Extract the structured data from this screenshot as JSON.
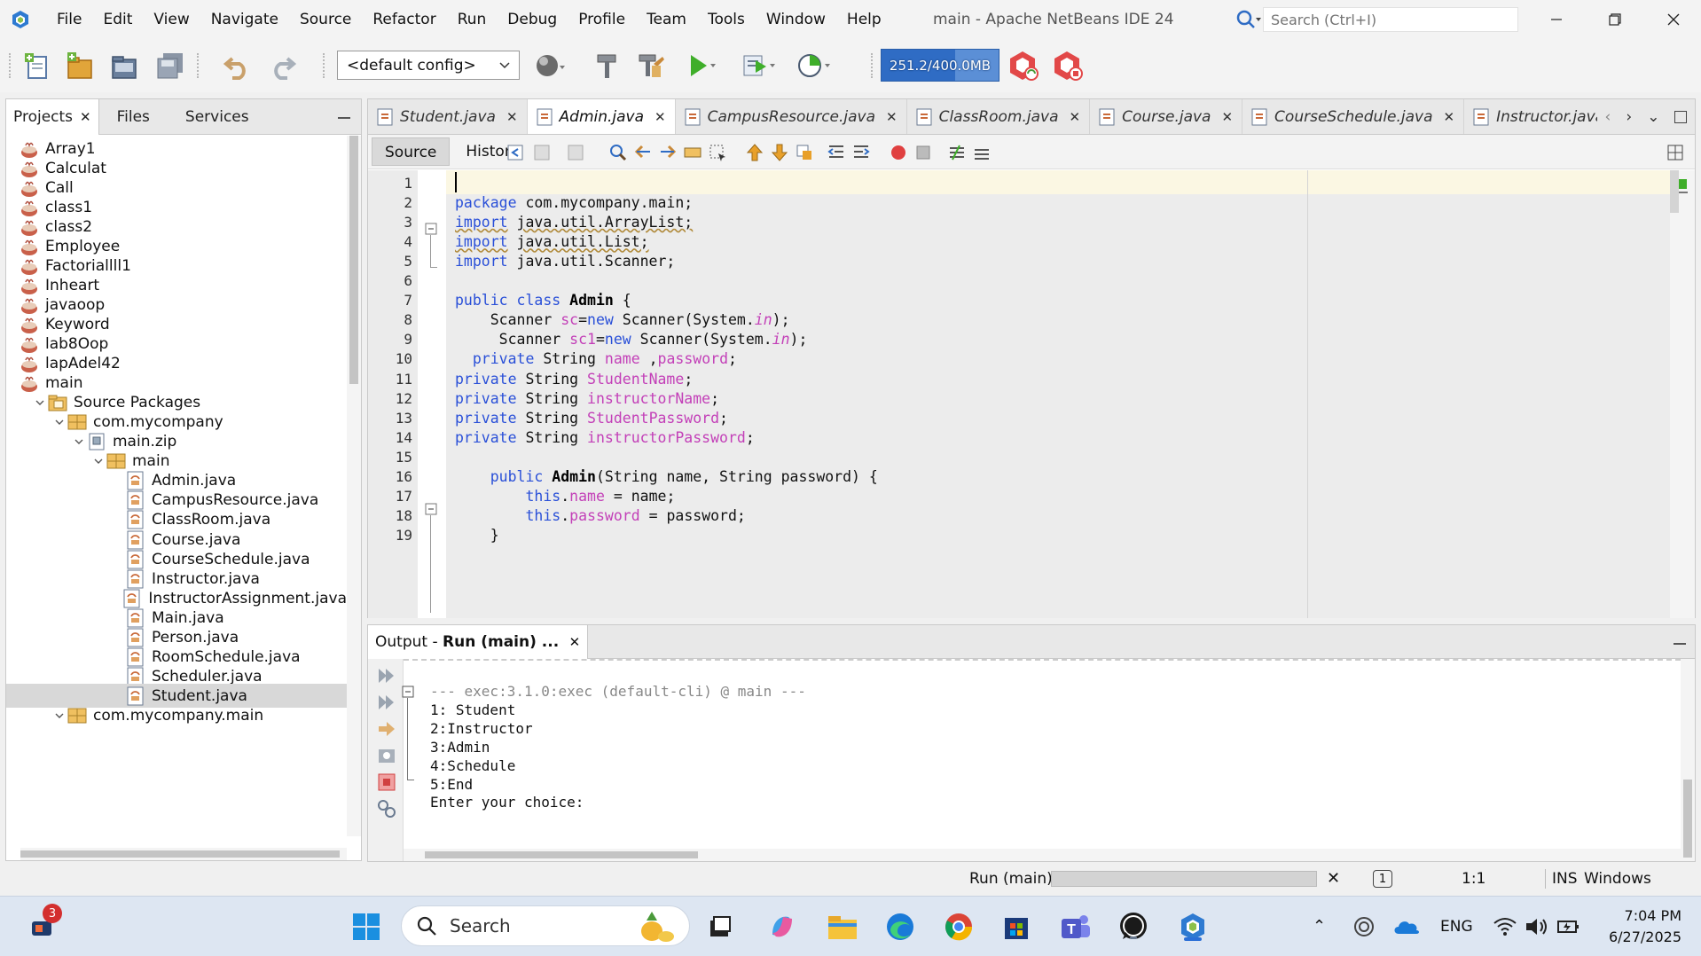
{
  "window": {
    "title": "main - Apache NetBeans IDE 24",
    "menu": [
      "File",
      "Edit",
      "View",
      "Navigate",
      "Source",
      "Refactor",
      "Run",
      "Debug",
      "Profile",
      "Team",
      "Tools",
      "Window",
      "Help"
    ],
    "search_placeholder": "Search (Ctrl+I)"
  },
  "toolbar": {
    "config_value": "<default config>",
    "memory_label": "251.2/400.0MB",
    "memory_fraction": 0.628
  },
  "projects_panel": {
    "tabs": [
      "Projects",
      "Files",
      "Services"
    ],
    "items": [
      {
        "label": "Array1"
      },
      {
        "label": "Calculat"
      },
      {
        "label": "Call"
      },
      {
        "label": "class1"
      },
      {
        "label": "class2"
      },
      {
        "label": "Employee"
      },
      {
        "label": "Factoriallll1"
      },
      {
        "label": "Inheart"
      },
      {
        "label": "javaoop"
      },
      {
        "label": "Keyword"
      },
      {
        "label": "lab8Oop"
      },
      {
        "label": "lapAdel42"
      },
      {
        "label": "main"
      },
      {
        "label": "Source Packages"
      },
      {
        "label": "com.mycompany"
      },
      {
        "label": "main.zip"
      },
      {
        "label": "main"
      },
      {
        "label": "Admin.java"
      },
      {
        "label": "CampusResource.java"
      },
      {
        "label": "ClassRoom.java"
      },
      {
        "label": "Course.java"
      },
      {
        "label": "CourseSchedule.java"
      },
      {
        "label": "Instructor.java"
      },
      {
        "label": "InstructorAssignment.java"
      },
      {
        "label": "Main.java"
      },
      {
        "label": "Person.java"
      },
      {
        "label": "RoomSchedule.java"
      },
      {
        "label": "Scheduler.java"
      },
      {
        "label": "Student.java"
      },
      {
        "label": "com.mycompany.main"
      }
    ]
  },
  "editor": {
    "tabs": [
      "Student.java",
      "Admin.java",
      "CampusResource.java",
      "ClassRoom.java",
      "Course.java",
      "CourseSchedule.java",
      "Instructor.java..."
    ],
    "active_tab": "Admin.java",
    "view_tabs": [
      "Source",
      "History"
    ],
    "line_numbers": [
      "1",
      "2",
      "3",
      "4",
      "5",
      "6",
      "7",
      "8",
      "9",
      "10",
      "11",
      "12",
      "13",
      "14",
      "15",
      "16",
      "17",
      "18",
      "19"
    ],
    "lines": [
      "",
      "package com.mycompany.main;",
      "import java.util.ArrayList;",
      "import java.util.List;",
      "import java.util.Scanner;",
      "",
      "public class Admin {",
      "    Scanner sc=new Scanner(System.in);",
      "     Scanner sc1=new Scanner(System.in);",
      "  private String name ,password;",
      "private String StudentName;",
      "private String instructorName;",
      "private String StudentPassword;",
      "private String instructorPassword;",
      "",
      "    public Admin(String name, String password) {",
      "        this.name = name;",
      "        this.password = password;",
      "    }"
    ]
  },
  "output": {
    "tab_prefix": "Output - ",
    "tab_title": "Run (main) ...",
    "lines": [
      "--- exec:3.1.0:exec (default-cli) @ main ---",
      "1: Student",
      "2:Instructor",
      "3:Admin",
      "4:Schedule",
      "5:End",
      "Enter your choice:"
    ]
  },
  "statusbar": {
    "run_label": "Run (main)",
    "notifications": "1",
    "position": "1:1",
    "insert_mode": "INS",
    "line_endings": "Windows (CRLF)"
  },
  "taskbar": {
    "search_label": "Search",
    "badge_count": "3",
    "language": "ENG",
    "time": "7:04 PM",
    "date": "6/27/2025"
  }
}
